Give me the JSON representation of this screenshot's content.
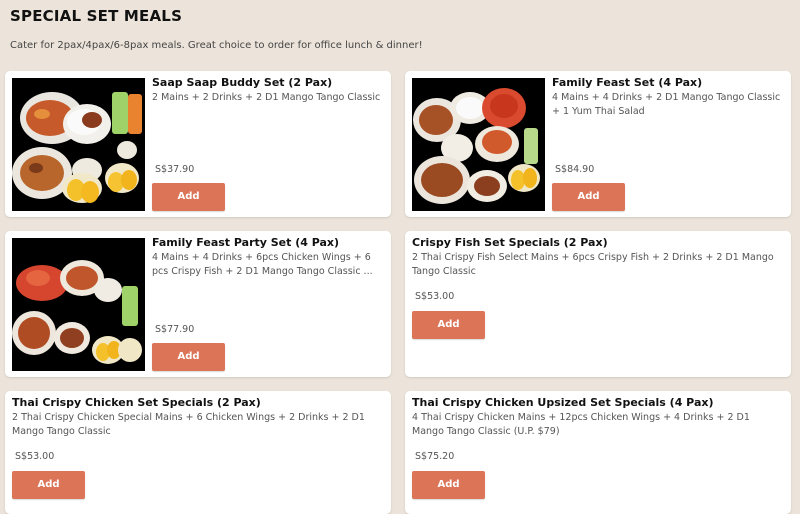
{
  "section": {
    "title": "SPECIAL SET MEALS",
    "description": "Cater for 2pax/4pax/6-8pax meals. Great choice to order for office lunch & dinner!"
  },
  "items": [
    {
      "title": "Saap Saap Buddy Set (2 Pax)",
      "description": "2 Mains + 2 Drinks + 2 D1 Mango Tango Classic",
      "price": "S$37.90",
      "add_label": "Add"
    },
    {
      "title": "Family Feast Set (4 Pax)",
      "description": "4 Mains + 4 Drinks + 2 D1 Mango Tango Classic + 1 Yum Thai Salad",
      "price": "S$84.90",
      "add_label": "Add"
    },
    {
      "title": "Family Feast Party Set (4 Pax)",
      "description": "4 Mains + 4 Drinks + 6pcs Chicken Wings + 6 pcs Crispy Fish + 2 D1 Mango Tango Classic ...",
      "price": "S$77.90",
      "add_label": "Add"
    },
    {
      "title": "Crispy Fish Set Specials (2 Pax)",
      "description": "2 Thai Crispy Fish Select Mains + 6pcs Crispy Fish + 2 Drinks + 2 D1 Mango Tango Classic",
      "price": "S$53.00",
      "add_label": "Add"
    },
    {
      "title": "Thai Crispy Chicken Set Specials (2 Pax)",
      "description": "2 Thai Crispy Chicken Special Mains + 6 Chicken Wings + 2 Drinks + 2 D1 Mango Tango Classic",
      "price": "S$53.00",
      "add_label": "Add"
    },
    {
      "title": "Thai Crispy Chicken Upsized Set Specials (4 Pax)",
      "description": "4 Thai Crispy Chicken Mains + 12pcs Chicken Wings + 4 Drinks +  2 D1 Mango Tango Classic (U.P. $79)",
      "price": "S$75.20",
      "add_label": "Add"
    }
  ]
}
